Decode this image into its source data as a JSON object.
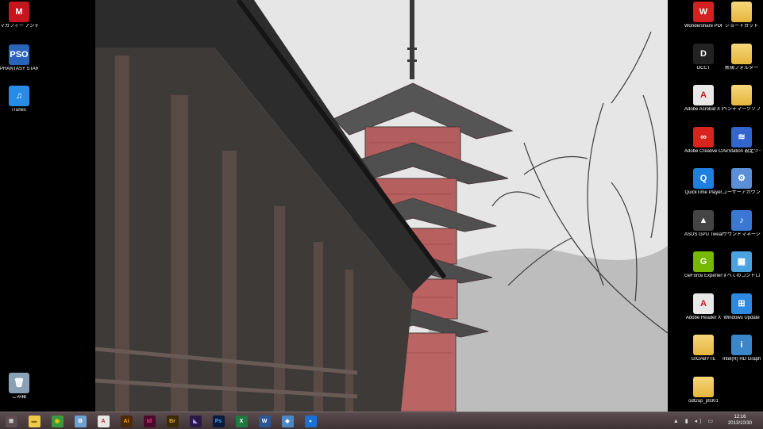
{
  "desktop": {
    "left_icons": [
      {
        "name": "mcafee-icon",
        "label": "マカフィー アンチウイルス プラス",
        "color": "#c4161c",
        "glyph": "M"
      },
      {
        "name": "pso2-icon",
        "label": "PHANTASY STAR ONLINE 2",
        "color": "#2a64b8",
        "glyph": "PSO"
      },
      {
        "name": "itunes-icon",
        "label": "iTunes",
        "color": "#2a8be6",
        "glyph": "♫"
      },
      {
        "name": "recycle-bin-icon",
        "label": "ごみ箱",
        "color": "#8aa0b4",
        "glyph": "🗑"
      }
    ],
    "right_icons": [
      {
        "name": "wondershare-icon",
        "label": "Wondershare PDFパスワード解除",
        "color": "#d42020",
        "glyph": "W"
      },
      {
        "name": "folder-icon",
        "label": "ショートカット",
        "color": "folder",
        "glyph": ""
      },
      {
        "name": "occt-icon",
        "label": "OCCT",
        "color": "#222222",
        "glyph": "D"
      },
      {
        "name": "folder-icon",
        "label": "新規フォルダー",
        "color": "folder",
        "glyph": ""
      },
      {
        "name": "acrobat-icon",
        "label": "Adobe Acrobat X Pro",
        "color": "#e8e8e8",
        "glyph": "A"
      },
      {
        "name": "folder-icon",
        "label": "ベンチマークソフト",
        "color": "folder",
        "glyph": ""
      },
      {
        "name": "creative-cloud-icon",
        "label": "Adobe Creative Cloud",
        "color": "#d9241e",
        "glyph": "∞"
      },
      {
        "name": "airstation-icon",
        "label": "AirStation 設定ツール",
        "color": "#3366cc",
        "glyph": "≋"
      },
      {
        "name": "quicktime-icon",
        "label": "QuickTime Player",
        "color": "#1d7fe0",
        "glyph": "Q"
      },
      {
        "name": "user-settings-icon",
        "label": "ユーザーアカウント",
        "color": "#5b8fd8",
        "glyph": "⚙"
      },
      {
        "name": "asus-gpu-tweak-icon",
        "label": "ASUS GPU Tweak",
        "color": "#444444",
        "glyph": "▲"
      },
      {
        "name": "sound-manager-icon",
        "label": "サウンドマネージャ",
        "color": "#3a78d4",
        "glyph": "♪"
      },
      {
        "name": "geforce-icon",
        "label": "GeForce Experience",
        "color": "#76b900",
        "glyph": "G"
      },
      {
        "name": "control-panel-icon",
        "label": "すべてのコントロール パネル項目",
        "color": "#4aa3df",
        "glyph": "▦"
      },
      {
        "name": "adobe-reader-icon",
        "label": "Adobe Reader X",
        "color": "#e8e8e8",
        "glyph": "A"
      },
      {
        "name": "windows-icon",
        "label": "Windows Update",
        "color": "#2d8ae0",
        "glyph": "⊞"
      },
      {
        "name": "folder-icon",
        "label": "GIGABYTE",
        "color": "folder",
        "glyph": ""
      },
      {
        "name": "intel-hd-icon",
        "label": "Intel(R) HD Graphics Control",
        "color": "#3a86c9",
        "glyph": "i"
      },
      {
        "name": "folder-icon",
        "label": "odt2up_ptcl01",
        "color": "folder",
        "glyph": ""
      }
    ]
  },
  "taskbar": {
    "pinned": [
      {
        "name": "start-button",
        "glyph": "⊞",
        "color": "#5d4c50",
        "fg": "#ffffff"
      },
      {
        "name": "file-explorer-icon",
        "glyph": "▬",
        "color": "#f0c84a",
        "fg": "#8a6a10"
      },
      {
        "name": "chrome-icon",
        "glyph": "◉",
        "color": "#3a9b3a",
        "fg": "#f4c20d"
      },
      {
        "name": "control-panel-icon",
        "glyph": "⚙",
        "color": "#6fa0d0",
        "fg": "#ffffff"
      },
      {
        "name": "acrobat-icon",
        "glyph": "A",
        "color": "#e6e6e6",
        "fg": "#cc1a1a"
      },
      {
        "name": "illustrator-icon",
        "glyph": "Ai",
        "color": "#4a2a0a",
        "fg": "#ff9a00"
      },
      {
        "name": "indesign-icon",
        "glyph": "Id",
        "color": "#4a0a2a",
        "fg": "#ff3b8a"
      },
      {
        "name": "bridge-icon",
        "glyph": "Br",
        "color": "#3a2a0a",
        "fg": "#e6a532"
      },
      {
        "name": "premiere-icon",
        "glyph": "◣",
        "color": "#2a1a4a",
        "fg": "#b8a0ff"
      },
      {
        "name": "photoshop-icon",
        "glyph": "Ps",
        "color": "#0a1a3a",
        "fg": "#31a8ff"
      },
      {
        "name": "excel-icon",
        "glyph": "X",
        "color": "#1e7a3e",
        "fg": "#ffffff"
      },
      {
        "name": "word-icon",
        "glyph": "W",
        "color": "#2b5797",
        "fg": "#ffffff"
      },
      {
        "name": "remote-desktop-icon",
        "glyph": "◆",
        "color": "#4a88c8",
        "fg": "#ffffff"
      },
      {
        "name": "settings-app-icon",
        "glyph": "●",
        "color": "#1c6fd0",
        "fg": "#bfe0ff"
      }
    ],
    "tray_glyphs": "▲ ▮ ◂) ▭",
    "clock_time": "12:16",
    "clock_date": "2013/10/30"
  }
}
